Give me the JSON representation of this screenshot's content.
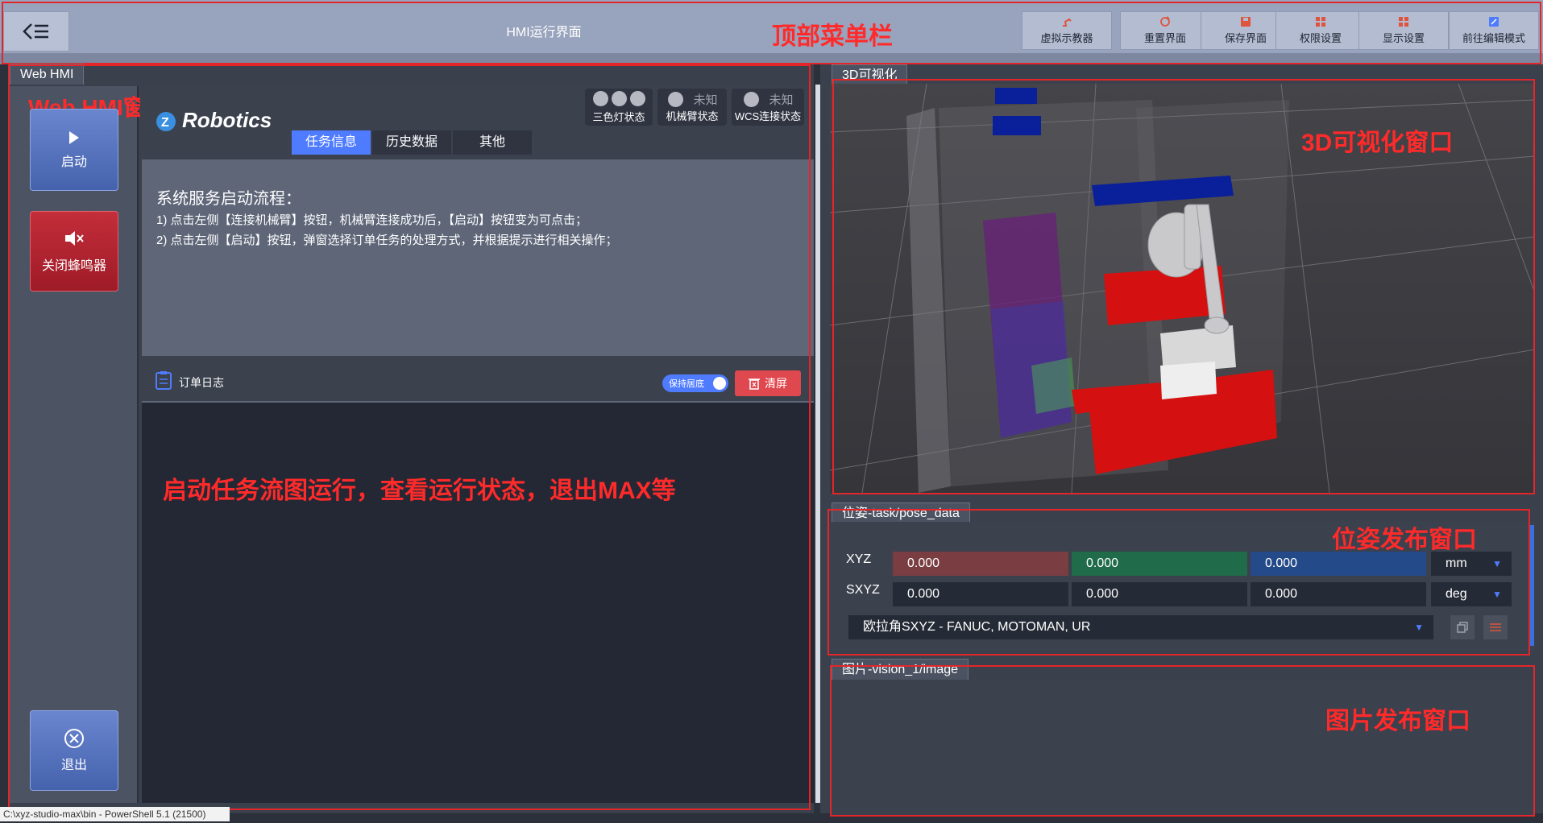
{
  "app": {
    "title": "HMI运行界面"
  },
  "toolbar": {
    "buttons": [
      {
        "label": "虚拟示教器",
        "icon": "robot-arm-icon",
        "color": "#e0533d"
      },
      {
        "label": "重置界面",
        "icon": "refresh-icon",
        "color": "#e0533d"
      },
      {
        "label": "保存界面",
        "icon": "save-icon",
        "color": "#e0533d"
      },
      {
        "label": "权限设置",
        "icon": "grid-icon",
        "color": "#e0533d"
      },
      {
        "label": "显示设置",
        "icon": "grid-icon",
        "color": "#e0533d"
      },
      {
        "label": "前往编辑模式",
        "icon": "edit-icon",
        "color": "#4f7cff"
      }
    ]
  },
  "annotations": {
    "top_menu": "顶部菜单栏",
    "webhmi_window": "Web HMI窗口",
    "viz_window": "3D可视化窗口",
    "pose_window": "位姿发布窗口",
    "image_window": "图片发布窗口",
    "log_hint": "启动任务流图运行，查看运行状态，退出MAX等"
  },
  "webhmi": {
    "tab_label": "Web HMI",
    "brand": "Robotics",
    "side_buttons": {
      "start": "启动",
      "buzzer": "关闭蜂鸣器",
      "exit": "退出"
    },
    "status": [
      {
        "label": "三色灯状态",
        "value": ""
      },
      {
        "label": "机械臂状态",
        "value": "未知"
      },
      {
        "label": "WCS连接状态",
        "value": "未知"
      }
    ],
    "tabs": [
      "任务信息",
      "历史数据",
      "其他"
    ],
    "active_tab": 0,
    "info": {
      "heading": "系统服务启动流程：",
      "line1": "1) 点击左侧【连接机械臂】按钮，机械臂连接成功后，【启动】按钮变为可点击；",
      "line2": "2) 点击左侧【启动】按钮，弹窗选择订单任务的处理方式，并根据提示进行相关操作；"
    },
    "log": {
      "title": "订单日志",
      "keep_bottom": "保持居底",
      "clear": "清屏"
    }
  },
  "viz": {
    "tab_label": "3D可视化"
  },
  "pose": {
    "tab_label": "位姿-task/pose_data",
    "rows": [
      {
        "label": "XYZ",
        "values": [
          "0.000",
          "0.000",
          "0.000"
        ],
        "unit": "mm"
      },
      {
        "label": "SXYZ",
        "values": [
          "0.000",
          "0.000",
          "0.000"
        ],
        "unit": "deg"
      }
    ],
    "xyz_colors": [
      "#7a3d42",
      "#1f6b4a",
      "#244a8a"
    ],
    "convention": "欧拉角SXYZ - FANUC, MOTOMAN, UR"
  },
  "image": {
    "tab_label": "图片-vision_1/image"
  },
  "statusbar": {
    "text": "C:\\xyz-studio-max\\bin - PowerShell 5.1 (21500)"
  }
}
